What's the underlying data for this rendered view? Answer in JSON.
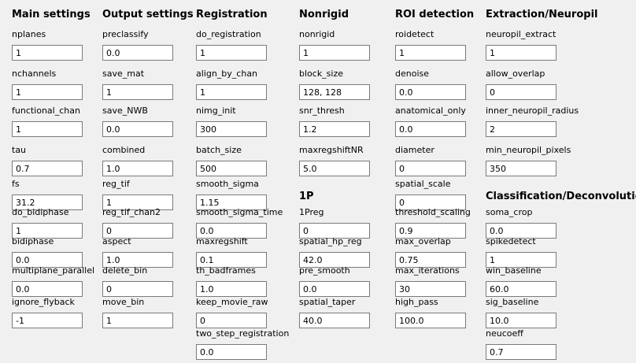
{
  "sections": [
    {
      "title": "Main settings",
      "fields": [
        {
          "label": "nplanes",
          "value": "1"
        },
        {
          "label": "nchannels",
          "value": "1"
        },
        {
          "label": "functional_chan",
          "value": "1"
        },
        {
          "label": "tau",
          "value": "0.7"
        },
        {
          "label": "fs",
          "value": "31.2"
        },
        {
          "label": "do_bidiphase",
          "value": "1"
        },
        {
          "label": "bidiphase",
          "value": "0.0"
        },
        {
          "label": "multiplane_parallel",
          "value": "0.0"
        },
        {
          "label": "ignore_flyback",
          "value": "-1"
        }
      ]
    },
    {
      "title": "Output settings",
      "fields": [
        {
          "label": "preclassify",
          "value": "0.0"
        },
        {
          "label": "save_mat",
          "value": "1"
        },
        {
          "label": "save_NWB",
          "value": "0.0"
        },
        {
          "label": "combined",
          "value": "1.0"
        },
        {
          "label": "reg_tif",
          "value": "1"
        },
        {
          "label": "reg_tif_chan2",
          "value": "0"
        },
        {
          "label": "aspect",
          "value": "1.0"
        },
        {
          "label": "delete_bin",
          "value": "0"
        },
        {
          "label": "move_bin",
          "value": "1"
        }
      ]
    },
    {
      "title": "Registration",
      "fields": [
        {
          "label": "do_registration",
          "value": "1"
        },
        {
          "label": "align_by_chan",
          "value": "1"
        },
        {
          "label": "nimg_init",
          "value": "300"
        },
        {
          "label": "batch_size",
          "value": "500"
        },
        {
          "label": "smooth_sigma",
          "value": "1.15"
        },
        {
          "label": "smooth_sigma_time",
          "value": "0.0"
        },
        {
          "label": "maxregshift",
          "value": "0.1"
        },
        {
          "label": "th_badframes",
          "value": "1.0"
        },
        {
          "label": "keep_movie_raw",
          "value": "0"
        },
        {
          "label": "two_step_registration",
          "value": "0.0"
        }
      ]
    },
    {
      "title": "Nonrigid",
      "fields": [
        {
          "label": "nonrigid",
          "value": "1"
        },
        {
          "label": "block_size",
          "value": "128, 128"
        },
        {
          "label": "snr_thresh",
          "value": "1.2"
        },
        {
          "label": "maxregshiftNR",
          "value": "5.0"
        }
      ]
    },
    {
      "title": "1P",
      "fields": [
        {
          "label": "1Preg",
          "value": "0"
        },
        {
          "label": "spatial_hp_reg",
          "value": "42.0"
        },
        {
          "label": "pre_smooth",
          "value": "0.0"
        },
        {
          "label": "spatial_taper",
          "value": "40.0"
        }
      ]
    },
    {
      "title": "ROI detection",
      "fields": [
        {
          "label": "roidetect",
          "value": "1"
        },
        {
          "label": "denoise",
          "value": "0.0"
        },
        {
          "label": "anatomical_only",
          "value": "0.0"
        },
        {
          "label": "diameter",
          "value": "0"
        },
        {
          "label": "spatial_scale",
          "value": "0"
        },
        {
          "label": "threshold_scaling",
          "value": "0.9"
        },
        {
          "label": "max_overlap",
          "value": "0.75"
        },
        {
          "label": "max_iterations",
          "value": "30"
        },
        {
          "label": "high_pass",
          "value": "100.0"
        }
      ]
    },
    {
      "title": "Extraction/Neuropil",
      "fields": [
        {
          "label": "neuropil_extract",
          "value": "1"
        },
        {
          "label": "allow_overlap",
          "value": "0"
        },
        {
          "label": "inner_neuropil_radius",
          "value": "2"
        },
        {
          "label": "min_neuropil_pixels",
          "value": "350"
        }
      ]
    },
    {
      "title": "Classification/Deconvolution",
      "fields": [
        {
          "label": "soma_crop",
          "value": "0.0"
        },
        {
          "label": "spikedetect",
          "value": "1"
        },
        {
          "label": "win_baseline",
          "value": "60.0"
        },
        {
          "label": "sig_baseline",
          "value": "10.0"
        },
        {
          "label": "neucoeff",
          "value": "0.7"
        }
      ]
    }
  ]
}
